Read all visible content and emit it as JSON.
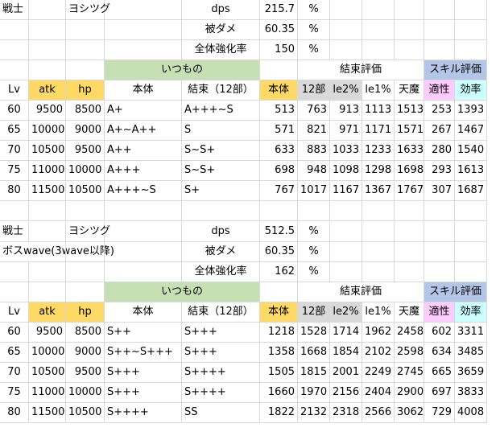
{
  "colors": {
    "green": "#c6e0b4",
    "orange": "#ffd966",
    "gray": "#d9d9d9",
    "blue": "#b4c6e7",
    "pink": "#ffccff",
    "cyan": "#ccffff",
    "grid": "#d9d9d9"
  },
  "blocks": [
    {
      "info": [
        [
          "戦士",
          "",
          "ヨシツグ",
          "",
          "dps",
          "215.7",
          "%"
        ],
        [
          "",
          "",
          "",
          "",
          "被ダメ",
          "60.35",
          "%"
        ],
        [
          "",
          "",
          "",
          "",
          "全体強化率",
          "150",
          "%"
        ]
      ],
      "groups": {
        "itsumono": "いつもの",
        "kessoku": "結束評価",
        "skill": "スキル評価"
      },
      "headers": [
        "Lv",
        "atk",
        "hp",
        "本体",
        "結束（12部）",
        "本体",
        "12部",
        "le2%",
        "le1%",
        "天魔",
        "適性",
        "効率"
      ],
      "rows": [
        [
          "60",
          "9500",
          "8500",
          "A+",
          "A+++~S",
          "513",
          "763",
          "913",
          "1113",
          "1513",
          "253",
          "1393"
        ],
        [
          "65",
          "10000",
          "9000",
          "A+~A++",
          "S",
          "571",
          "821",
          "971",
          "1171",
          "1571",
          "267",
          "1467"
        ],
        [
          "70",
          "10500",
          "9500",
          "A++",
          "S~S+",
          "633",
          "883",
          "1033",
          "1233",
          "1633",
          "280",
          "1540"
        ],
        [
          "75",
          "11000",
          "10000",
          "A+++",
          "S~S+",
          "698",
          "948",
          "1098",
          "1298",
          "1698",
          "293",
          "1613"
        ],
        [
          "80",
          "11500",
          "10500",
          "A+++~S",
          "S+",
          "767",
          "1017",
          "1167",
          "1367",
          "1767",
          "307",
          "1687"
        ]
      ]
    },
    {
      "info": [
        [
          "戦士",
          "",
          "ヨシツグ",
          "",
          "dps",
          "512.5",
          "%"
        ],
        [
          "ボスwave(3wave以降)",
          "",
          "",
          "",
          "被ダメ",
          "60.35",
          "%"
        ],
        [
          "",
          "",
          "",
          "",
          "全体強化率",
          "162",
          "%"
        ]
      ],
      "groups": {
        "itsumono": "いつもの",
        "kessoku": "結束評価",
        "skill": "スキル評価"
      },
      "headers": [
        "Lv",
        "atk",
        "hp",
        "本体",
        "結束（12部）",
        "本体",
        "12部",
        "le2%",
        "le1%",
        "天魔",
        "適性",
        "効率"
      ],
      "rows": [
        [
          "60",
          "9500",
          "8500",
          "S++",
          "S+++",
          "1218",
          "1528",
          "1714",
          "1962",
          "2458",
          "602",
          "3311"
        ],
        [
          "65",
          "10000",
          "9000",
          "S++~S+++",
          "S+++",
          "1358",
          "1668",
          "1854",
          "2102",
          "2598",
          "634",
          "3485"
        ],
        [
          "70",
          "10500",
          "9500",
          "S+++",
          "S++++",
          "1505",
          "1815",
          "2001",
          "2249",
          "2745",
          "665",
          "3659"
        ],
        [
          "75",
          "11000",
          "10000",
          "S+++",
          "S++++",
          "1660",
          "1970",
          "2156",
          "2404",
          "2900",
          "697",
          "3833"
        ],
        [
          "80",
          "11500",
          "10500",
          "S++++",
          "SS",
          "1822",
          "2132",
          "2318",
          "2566",
          "3062",
          "729",
          "4008"
        ]
      ]
    }
  ]
}
